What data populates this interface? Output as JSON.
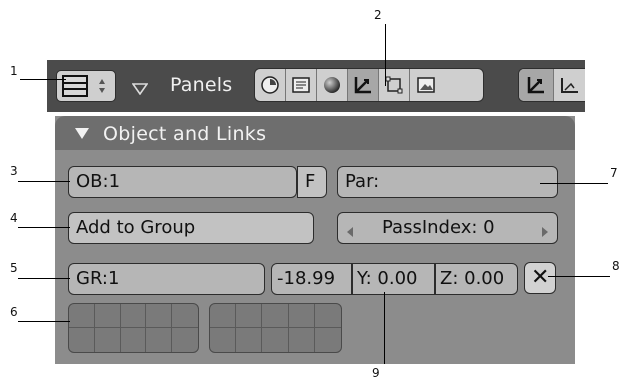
{
  "header": {
    "panels_label": "Panels"
  },
  "panel": {
    "title": "Object and Links",
    "ob_field": "OB:1",
    "fake_user_label": "F",
    "parent_field": "Par:",
    "add_to_group_label": "Add to Group",
    "pass_index": "PassIndex: 0",
    "group_field": "GR:1",
    "offset_x": "-18.99",
    "offset_y": "Y: 0.00",
    "offset_z": "Z: 0.00",
    "close_label": "✕"
  },
  "callouts": [
    "1",
    "2",
    "3",
    "4",
    "5",
    "6",
    "7",
    "8",
    "9"
  ],
  "colors": {
    "header_bg": "#4b4b4b",
    "panel_bg": "#8c8c8c",
    "panel_title_bg": "#6e6e6e",
    "field_bg": "#b6b6b6"
  }
}
